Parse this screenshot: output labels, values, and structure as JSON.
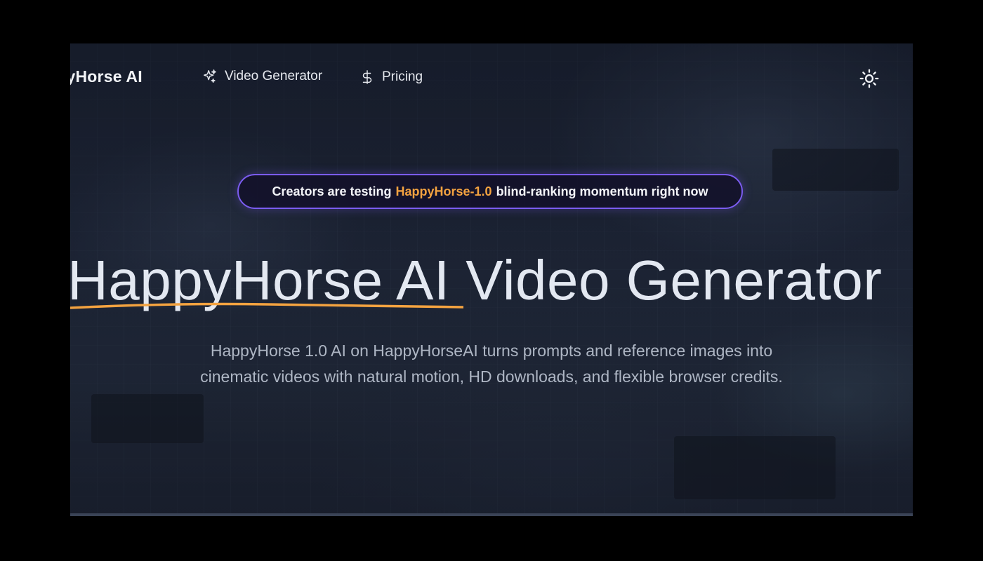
{
  "nav": {
    "logo": "ppyHorse AI",
    "links": [
      {
        "label": "Video Generator",
        "icon": "sparkles-icon"
      },
      {
        "label": "Pricing",
        "icon": "dollar-icon"
      }
    ],
    "theme_toggle_icon": "sun-icon"
  },
  "banner": {
    "prefix": "Creators are testing",
    "highlight": "HappyHorse-1.0",
    "suffix": "blind-ranking momentum right now"
  },
  "hero": {
    "title_brand": "HappyHorse AI",
    "title_rest": "Video Generator",
    "subtitle_line1": "HappyHorse 1.0 AI on HappyHorseAI turns prompts and reference images into",
    "subtitle_line2": "cinematic videos with natural motion, HD downloads, and flexible browser credits."
  },
  "colors": {
    "accent_orange": "#f4a340",
    "banner_border": "#7b5cf0",
    "background": "#1e2638"
  }
}
